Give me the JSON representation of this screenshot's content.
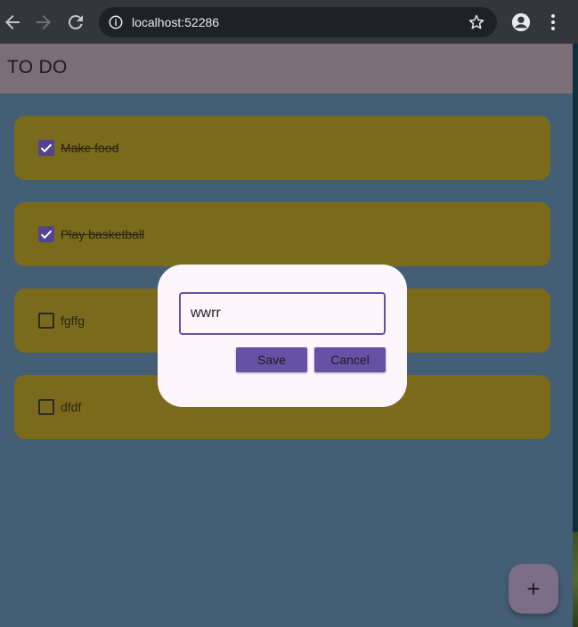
{
  "browser": {
    "url": "localhost:52286",
    "icons": [
      "back-icon",
      "forward-icon",
      "reload-icon",
      "info-icon",
      "star-icon",
      "profile-icon",
      "more-vert-icon"
    ]
  },
  "app": {
    "title": "TO DO",
    "colors": {
      "app_bar": "#7b6e75",
      "background": "#445e75",
      "card": "#7a6b1c",
      "accent": "#6552a5"
    }
  },
  "todos": [
    {
      "label": "Make food",
      "checked": true
    },
    {
      "label": "Play basketball",
      "checked": true
    },
    {
      "label": "fgffg",
      "checked": false
    },
    {
      "label": "dfdf",
      "checked": false
    }
  ],
  "dialog": {
    "input_value": "wwrr",
    "save_label": "Save",
    "cancel_label": "Cancel"
  },
  "fab": {
    "icon": "add-icon",
    "glyph": "+"
  }
}
